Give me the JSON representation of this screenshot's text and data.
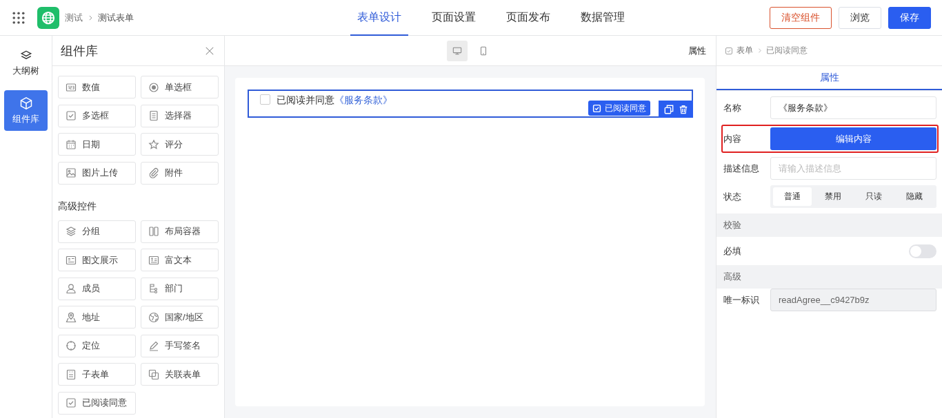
{
  "header": {
    "breadcrumb": [
      "测试",
      "测试表单"
    ],
    "tabs": [
      {
        "label": "表单设计",
        "selected": true
      },
      {
        "label": "页面设置",
        "selected": false
      },
      {
        "label": "页面发布",
        "selected": false
      },
      {
        "label": "数据管理",
        "selected": false
      }
    ],
    "buttons": [
      {
        "label": "清空组件",
        "kind": "danger"
      },
      {
        "label": "浏览",
        "kind": "default"
      },
      {
        "label": "保存",
        "kind": "primary"
      }
    ]
  },
  "rail": [
    {
      "label": "大纲树",
      "selected": false
    },
    {
      "label": "组件库",
      "selected": true
    }
  ],
  "library": {
    "title": "组件库",
    "sections": [
      {
        "items": [
          "数值",
          "单选框",
          "多选框",
          "选择器",
          "日期",
          "评分",
          "图片上传",
          "附件"
        ]
      },
      {
        "title": "高级控件",
        "items": [
          "分组",
          "布局容器",
          "图文展示",
          "富文本",
          "成员",
          "部门",
          "地址",
          "国家/地区",
          "定位",
          "手写签名",
          "子表单",
          "关联表单",
          "已阅读同意"
        ]
      }
    ]
  },
  "canvas": {
    "devices": [
      {
        "selected": true
      },
      {
        "selected": false
      }
    ],
    "panel_label": "属性",
    "field": {
      "selected": true,
      "checked": false,
      "text": "已阅读并同意",
      "link": "《服务条款》",
      "badge": "已阅读同意"
    }
  },
  "properties": {
    "breadcrumb": [
      "表单",
      "已阅读同意"
    ],
    "tabs": [
      {
        "label": "属性",
        "selected": true
      }
    ],
    "rows": [
      {
        "kind": "input",
        "label": "名称",
        "value": "《服务条款》",
        "disabled": false
      },
      {
        "kind": "button",
        "label": "内容",
        "button": "编辑内容",
        "highlighted": true
      },
      {
        "kind": "input",
        "label": "描述信息",
        "placeholder": "请输入描述信息",
        "disabled": false
      },
      {
        "kind": "segmented",
        "label": "状态",
        "options": [
          {
            "label": "普通",
            "selected": true
          },
          {
            "label": "禁用",
            "selected": false
          },
          {
            "label": "只读",
            "selected": false
          },
          {
            "label": "隐藏",
            "selected": false
          }
        ]
      },
      {
        "kind": "section",
        "label": "校验"
      },
      {
        "kind": "switch",
        "label": "必填",
        "on": false
      },
      {
        "kind": "section",
        "label": "高级"
      },
      {
        "kind": "input",
        "label": "唯一标识",
        "value": "readAgree__c9427b9z",
        "disabled": true
      }
    ]
  }
}
